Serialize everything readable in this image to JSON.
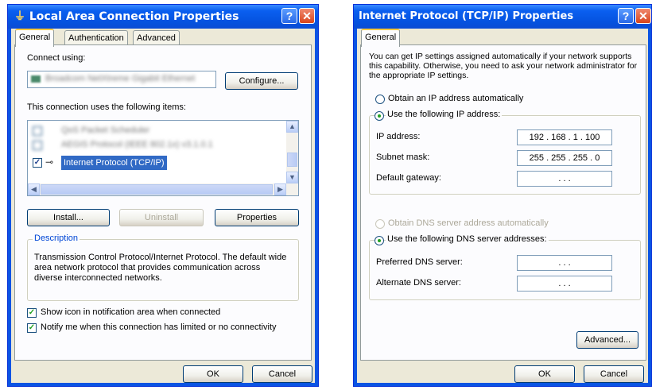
{
  "left_dialog": {
    "title": "Local Area Connection Properties",
    "tabs": [
      "General",
      "Authentication",
      "Advanced"
    ],
    "connect_using_label": "Connect using:",
    "adapter_name": "Broadcom NetXtreme Gigabit Ethernet",
    "configure_button": "Configure...",
    "items_label": "This connection uses the following items:",
    "items": [
      {
        "label": "QoS Packet Scheduler",
        "checked": true
      },
      {
        "label": "AEGIS Protocol (IEEE 802.1x) v3.1.0.1",
        "checked": true
      },
      {
        "label": "Internet Protocol (TCP/IP)",
        "checked": true
      }
    ],
    "install_button": "Install...",
    "uninstall_button": "Uninstall",
    "properties_button": "Properties",
    "description_legend": "Description",
    "description_text": "Transmission Control Protocol/Internet Protocol. The default wide area network protocol that provides communication across diverse interconnected networks.",
    "show_icon_label": "Show icon in notification area when connected",
    "notify_label": "Notify me when this connection has limited or no connectivity",
    "ok_button": "OK",
    "cancel_button": "Cancel"
  },
  "right_dialog": {
    "title": "Internet Protocol (TCP/IP) Properties",
    "tab": "General",
    "intro_text": "You can get IP settings assigned automatically if your network supports this capability. Otherwise, you need to ask your network administrator for the appropriate IP settings.",
    "obtain_ip_auto": "Obtain an IP address automatically",
    "use_following_ip": "Use the following IP address:",
    "ip_address_label": "IP address:",
    "ip_address_value": "192 . 168 .  1  . 100",
    "subnet_mask_label": "Subnet mask:",
    "subnet_mask_value": "255 . 255 . 255 .  0",
    "default_gateway_label": "Default gateway:",
    "default_gateway_value": ".        .        .",
    "obtain_dns_auto": "Obtain DNS server address automatically",
    "use_following_dns": "Use the following DNS server addresses:",
    "preferred_dns_label": "Preferred DNS server:",
    "preferred_dns_value": ".        .        .",
    "alternate_dns_label": "Alternate DNS server:",
    "alternate_dns_value": ".        .        .",
    "advanced_button": "Advanced...",
    "ok_button": "OK",
    "cancel_button": "Cancel"
  },
  "icons": {
    "window_icon": "network-connection-icon",
    "help": "?",
    "close": "✕",
    "check": "✓",
    "arrow_up": "▲",
    "arrow_down": "▼",
    "arrow_left": "◀",
    "arrow_right": "▶"
  }
}
